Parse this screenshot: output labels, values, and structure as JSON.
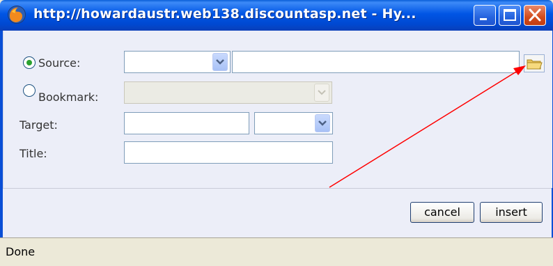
{
  "window": {
    "title": "http://howardaustr.web138.discountasp.net - Hy..."
  },
  "form": {
    "source_label": "Source:",
    "source_selected": true,
    "bookmark_label": "Bookmark:",
    "bookmark_selected": false,
    "target_label": "Target:",
    "title_label": "Title:",
    "source_type_value": "",
    "source_url_value": "",
    "bookmark_value": "",
    "target_value": "",
    "target_select_value": "",
    "title_value": ""
  },
  "buttons": {
    "cancel": "cancel",
    "insert": "insert"
  },
  "status": {
    "text": "Done"
  },
  "colors": {
    "titlebar": "#0055E5",
    "content_bg": "#ECEEF8",
    "annotation_arrow": "#FF0000"
  }
}
